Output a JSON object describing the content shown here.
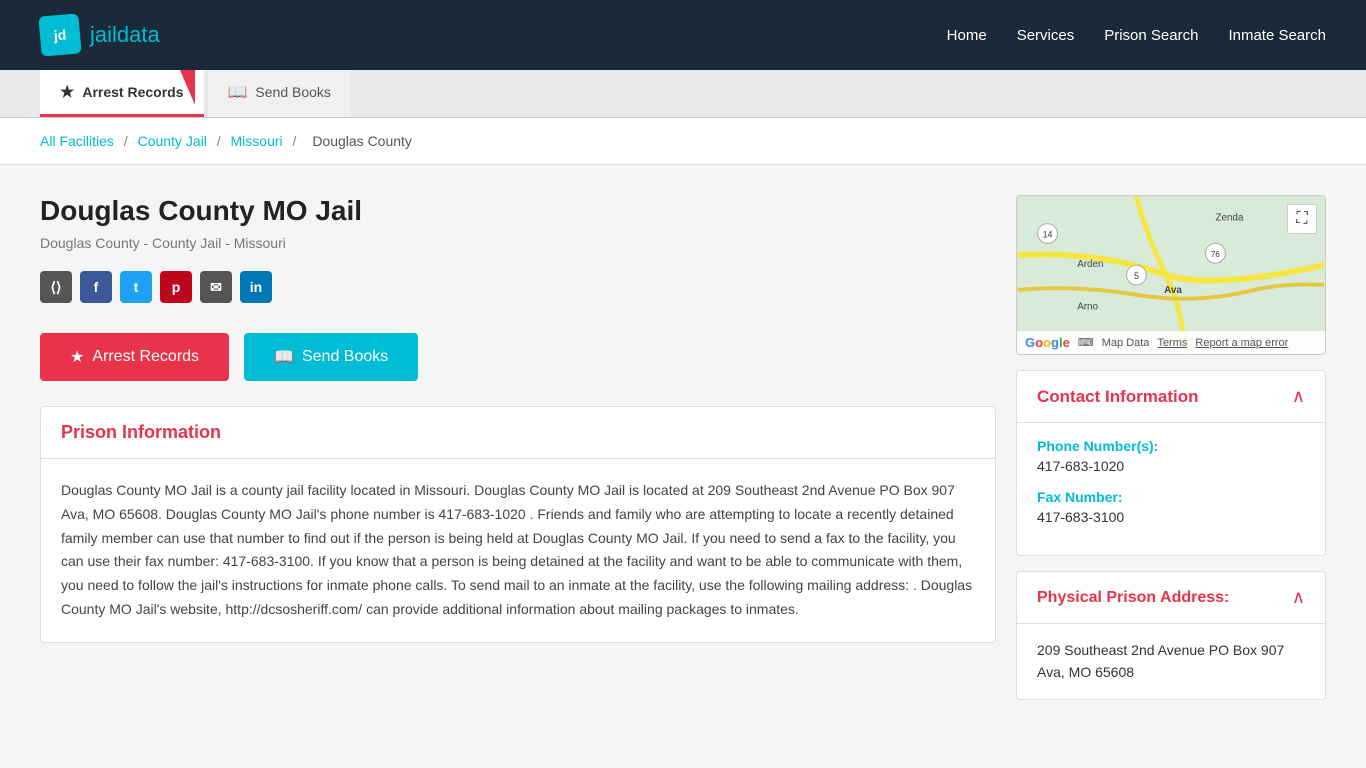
{
  "header": {
    "logo_text_jd": "jd",
    "logo_text_jail": "jail",
    "logo_text_data": "data",
    "nav": {
      "home": "Home",
      "services": "Services",
      "prison_search": "Prison Search",
      "inmate_search": "Inmate Search"
    }
  },
  "tabs": {
    "arrest_records": "Arrest Records",
    "send_books": "Send Books"
  },
  "breadcrumb": {
    "all_facilities": "All Facilities",
    "county_jail": "County Jail",
    "missouri": "Missouri",
    "current": "Douglas County"
  },
  "facility": {
    "title": "Douglas County MO Jail",
    "subtitle": "Douglas County - County Jail - Missouri"
  },
  "social": {
    "share": "Share",
    "facebook": "f",
    "twitter": "t",
    "pinterest": "p",
    "email": "✉",
    "linkedin": "in"
  },
  "buttons": {
    "arrest_records": "Arrest Records",
    "send_books": "Send Books"
  },
  "prison_info": {
    "title": "Prison Information",
    "body": "Douglas County MO Jail is a county jail facility located in Missouri. Douglas County MO Jail is located at 209 Southeast 2nd Avenue PO Box 907 Ava, MO 65608. Douglas County MO Jail's phone number is 417-683-1020 . Friends and family who are attempting to locate a recently detained family member can use that number to find out if the person is being held at Douglas County MO Jail. If you need to send a fax to the facility, you can use their fax number: 417-683-3100. If you know that a person is being detained at the facility and want to be able to communicate with them, you need to follow the jail's instructions for inmate phone calls. To send mail to an inmate at the facility, use the following mailing address: . Douglas County MO Jail's website, http://dcsosheriff.com/ can provide additional information about mailing packages to inmates."
  },
  "contact": {
    "title": "Contact Information",
    "phone_label": "Phone Number(s):",
    "phone_value": "417-683-1020",
    "fax_label": "Fax Number:",
    "fax_value": "417-683-3100"
  },
  "address": {
    "title": "Physical Prison Address:",
    "value": "209 Southeast 2nd Avenue PO Box 907\nAva, MO 65608"
  },
  "map": {
    "expand_icon": "⛶",
    "keyboard_icon": "⌨",
    "map_data": "Map Data",
    "terms": "Terms",
    "report": "Report a map error",
    "labels": {
      "zenda": "Zenda",
      "arden": "Arden",
      "arno": "Arno",
      "ava": "Ava",
      "route5": "5",
      "route14": "14",
      "route76": "76"
    }
  }
}
